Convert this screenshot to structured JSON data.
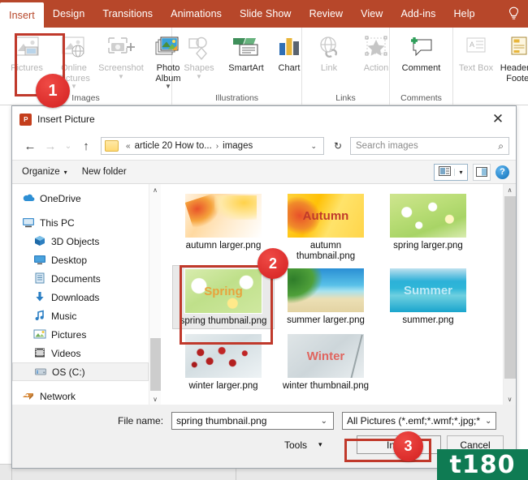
{
  "ribbon": {
    "tabs": [
      {
        "label": "Insert",
        "active": true
      },
      {
        "label": "Design",
        "active": false
      },
      {
        "label": "Transitions",
        "active": false
      },
      {
        "label": "Animations",
        "active": false
      },
      {
        "label": "Slide Show",
        "active": false
      },
      {
        "label": "Review",
        "active": false
      },
      {
        "label": "View",
        "active": false
      },
      {
        "label": "Add-ins",
        "active": false
      },
      {
        "label": "Help",
        "active": false
      }
    ],
    "tell_me_icon": "lightbulb-icon",
    "groups": [
      {
        "label": "Images",
        "buttons": [
          {
            "label": "Pictures",
            "icon": "pictures-icon",
            "disabled": true
          },
          {
            "label": "Online Pictures",
            "icon": "online-pictures-icon",
            "disabled": true
          },
          {
            "label": "Screenshot",
            "icon": "screenshot-icon",
            "disabled": true
          },
          {
            "label": "Photo Album",
            "icon": "photo-album-icon",
            "disabled": false
          }
        ]
      },
      {
        "label": "Illustrations",
        "buttons": [
          {
            "label": "Shapes",
            "icon": "shapes-icon",
            "disabled": true
          },
          {
            "label": "SmartArt",
            "icon": "smartart-icon",
            "disabled": false
          },
          {
            "label": "Chart",
            "icon": "chart-icon",
            "disabled": false
          }
        ]
      },
      {
        "label": "Links",
        "buttons": [
          {
            "label": "Link",
            "icon": "link-icon",
            "disabled": true
          },
          {
            "label": "Action",
            "icon": "action-icon",
            "disabled": true
          }
        ]
      },
      {
        "label": "Comments",
        "buttons": [
          {
            "label": "Comment",
            "icon": "comment-icon",
            "disabled": false
          }
        ]
      },
      {
        "label": "",
        "buttons": [
          {
            "label": "Text Box",
            "icon": "text-box-icon",
            "disabled": true
          },
          {
            "label": "Header & Footer",
            "icon": "header-footer-icon",
            "disabled": false
          }
        ]
      }
    ]
  },
  "dialog": {
    "title": "Insert Picture",
    "app_icon": "powerpoint-icon",
    "close_label": "✕",
    "nav": {
      "back_icon": "arrow-left-icon",
      "forward_icon": "arrow-right-icon",
      "recent_icon": "chevron-down-icon",
      "up_icon": "arrow-up-icon",
      "folder_icon": "folder-icon",
      "breadcrumb_prefix": "«",
      "breadcrumb": [
        "article 20 How to...",
        "images"
      ],
      "breadcrumb_separator": "›",
      "dropdown_icon": "chevron-down-icon",
      "refresh_icon": "refresh-icon",
      "search_placeholder": "Search images",
      "search_value": "",
      "search_icon": "search-icon"
    },
    "toolbar": {
      "organize_label": "Organize",
      "organize_caret": "▾",
      "new_folder_label": "New folder",
      "view_icon": "view-layout-icon",
      "view_caret": "▾",
      "preview_pane_icon": "preview-pane-icon",
      "help_icon": "help-icon",
      "help_label": "?"
    },
    "navpane": {
      "items": [
        {
          "label": "OneDrive",
          "icon": "onedrive-icon",
          "indent": false,
          "selected": false
        },
        {
          "label": "This PC",
          "icon": "this-pc-icon",
          "indent": false,
          "selected": false
        },
        {
          "label": "3D Objects",
          "icon": "3d-objects-icon",
          "indent": true,
          "selected": false
        },
        {
          "label": "Desktop",
          "icon": "desktop-icon",
          "indent": true,
          "selected": false
        },
        {
          "label": "Documents",
          "icon": "documents-icon",
          "indent": true,
          "selected": false
        },
        {
          "label": "Downloads",
          "icon": "downloads-icon",
          "indent": true,
          "selected": false
        },
        {
          "label": "Music",
          "icon": "music-icon",
          "indent": true,
          "selected": false
        },
        {
          "label": "Pictures",
          "icon": "pictures-folder-icon",
          "indent": true,
          "selected": false
        },
        {
          "label": "Videos",
          "icon": "videos-icon",
          "indent": true,
          "selected": false
        },
        {
          "label": "OS (C:)",
          "icon": "drive-icon",
          "indent": true,
          "selected": true
        },
        {
          "label": "Network",
          "icon": "network-icon",
          "indent": false,
          "selected": false
        }
      ]
    },
    "files": [
      {
        "name": "autumn larger.png",
        "art": "th-autumn-l",
        "caption": "",
        "selected": false
      },
      {
        "name": "autumn thumbnail.png",
        "art": "th-autumn-t",
        "caption": "Autumn",
        "selected": false
      },
      {
        "name": "spring larger.png",
        "art": "th-spring-l",
        "caption": "",
        "selected": false
      },
      {
        "name": "spring thumbnail.png",
        "art": "th-spring-t",
        "caption": "Spring",
        "selected": true
      },
      {
        "name": "summer larger.png",
        "art": "th-summer-l",
        "caption": "",
        "selected": false
      },
      {
        "name": "summer.png",
        "art": "th-summer-t",
        "caption": "Summer",
        "selected": false
      },
      {
        "name": "winter larger.png",
        "art": "th-winter-l",
        "caption": "",
        "selected": false
      },
      {
        "name": "winter thumbnail.png",
        "art": "th-winter-t",
        "caption": "Winter",
        "selected": false
      }
    ],
    "footer": {
      "filename_label": "File name:",
      "filename_value": "spring thumbnail.png",
      "filename_caret": "⌄",
      "filetype_value": "All Pictures (*.emf;*.wmf;*.jpg;*",
      "filetype_caret": "⌄",
      "tools_label": "Tools",
      "tools_caret": "▾",
      "insert_label": "Insert",
      "cancel_label": "Cancel"
    },
    "scroll": {
      "up_arrow": "∧",
      "down_arrow": "∨"
    }
  },
  "annotations": {
    "badges": [
      {
        "number": "1"
      },
      {
        "number": "2"
      },
      {
        "number": "3"
      }
    ],
    "accent_color": "#c0392b",
    "badge_color": "#d32020"
  },
  "watermark": {
    "text": "t180",
    "background": "#0f7b53"
  }
}
